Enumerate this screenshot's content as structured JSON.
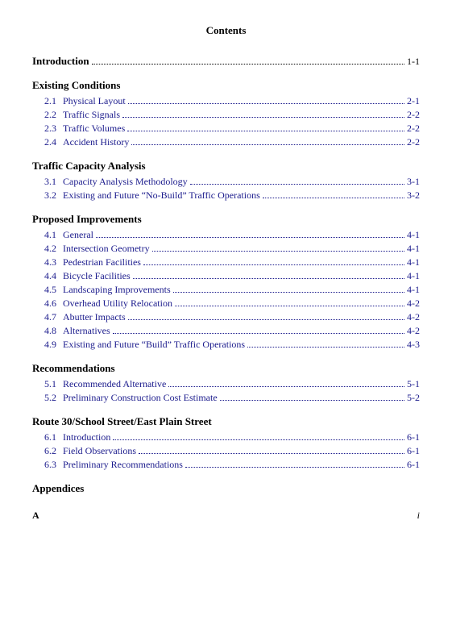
{
  "page": {
    "title": "Contents",
    "footer": {
      "left": "A",
      "right": "i"
    }
  },
  "sections": [
    {
      "id": "intro",
      "heading": "Introduction",
      "isTopLevel": true,
      "page": "1-1",
      "entries": []
    },
    {
      "id": "existing-conditions",
      "heading": "Existing Conditions",
      "isTopLevel": false,
      "entries": [
        {
          "number": "2.1",
          "label": "Physical Layout",
          "page": "2-1"
        },
        {
          "number": "2.2",
          "label": "Traffic Signals",
          "page": "2-2"
        },
        {
          "number": "2.3",
          "label": "Traffic Volumes",
          "page": "2-2"
        },
        {
          "number": "2.4",
          "label": "Accident History",
          "page": "2-2"
        }
      ]
    },
    {
      "id": "traffic-capacity",
      "heading": "Traffic Capacity Analysis",
      "isTopLevel": false,
      "entries": [
        {
          "number": "3.1",
          "label": "Capacity Analysis Methodology",
          "page": "3-1"
        },
        {
          "number": "3.2",
          "label": "Existing and Future “No-Build” Traffic Operations",
          "page": "3-2"
        }
      ]
    },
    {
      "id": "proposed-improvements",
      "heading": "Proposed Improvements",
      "isTopLevel": false,
      "entries": [
        {
          "number": "4.1",
          "label": "General",
          "page": "4-1"
        },
        {
          "number": "4.2",
          "label": "Intersection Geometry",
          "page": "4-1"
        },
        {
          "number": "4.3",
          "label": "Pedestrian Facilities",
          "page": "4-1"
        },
        {
          "number": "4.4",
          "label": "Bicycle Facilities",
          "page": "4-1"
        },
        {
          "number": "4.5",
          "label": "Landscaping Improvements",
          "page": "4-1"
        },
        {
          "number": "4.6",
          "label": "Overhead Utility Relocation",
          "page": "4-2"
        },
        {
          "number": "4.7",
          "label": "Abutter Impacts",
          "page": "4-2"
        },
        {
          "number": "4.8",
          "label": "Alternatives",
          "page": "4-2"
        },
        {
          "number": "4.9",
          "label": "Existing and Future “Build” Traffic Operations",
          "page": "4-3"
        }
      ]
    },
    {
      "id": "recommendations",
      "heading": "Recommendations",
      "isTopLevel": false,
      "entries": [
        {
          "number": "5.1",
          "label": "Recommended Alternative",
          "page": "5-1"
        },
        {
          "number": "5.2",
          "label": "Preliminary Construction Cost Estimate",
          "page": "5-2"
        }
      ]
    },
    {
      "id": "route30",
      "heading": "Route 30/School Street/East Plain Street",
      "isTopLevel": false,
      "entries": [
        {
          "number": "6.1",
          "label": "Introduction",
          "page": "6-1"
        },
        {
          "number": "6.2",
          "label": "Field Observations",
          "page": "6-1"
        },
        {
          "number": "6.3",
          "label": "Preliminary Recommendations",
          "page": "6-1"
        }
      ]
    },
    {
      "id": "appendices",
      "heading": "Appendices",
      "isTopLevel": false,
      "entries": []
    }
  ]
}
